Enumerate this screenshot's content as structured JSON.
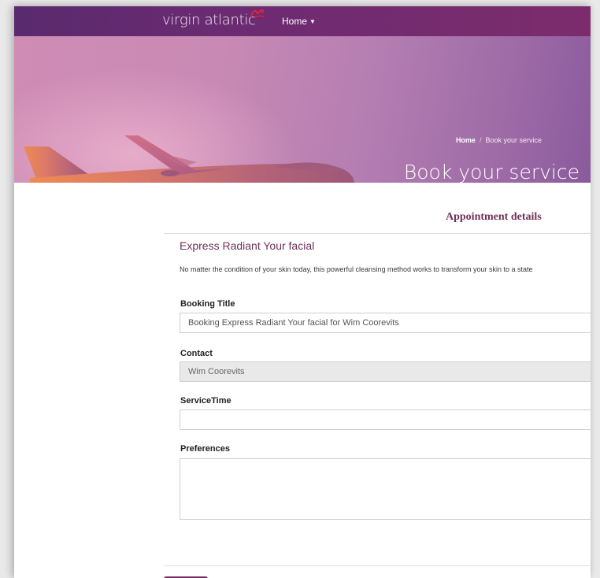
{
  "navbar": {
    "brand": "virgin atlantic",
    "brand_mark": "Virgin",
    "home_label": "Home",
    "home_caret_icon": "caret-down-icon"
  },
  "hero": {
    "breadcrumb_home": "Home",
    "breadcrumb_separator": "/",
    "breadcrumb_current": "Book your service",
    "title": "Book your service"
  },
  "form": {
    "section_title": "Appointment details",
    "service_name": "Express Radiant Your facial",
    "service_description": "No matter the condition of your skin today, this powerful cleansing method works to transform your skin to a state",
    "fields": {
      "booking_title": {
        "label": "Booking Title",
        "value": "Booking Express Radiant Your facial for Wim Coorevits"
      },
      "contact": {
        "label": "Contact",
        "value": "Wim Coorevits"
      },
      "service_time": {
        "label": "ServiceTime",
        "value": ""
      },
      "preferences": {
        "label": "Preferences",
        "value": ""
      }
    }
  },
  "colors": {
    "navbar": "#6a2b70",
    "accent": "#6e3158",
    "hero_light": "#cf8db5",
    "hero_dark": "#8a5a9c"
  }
}
